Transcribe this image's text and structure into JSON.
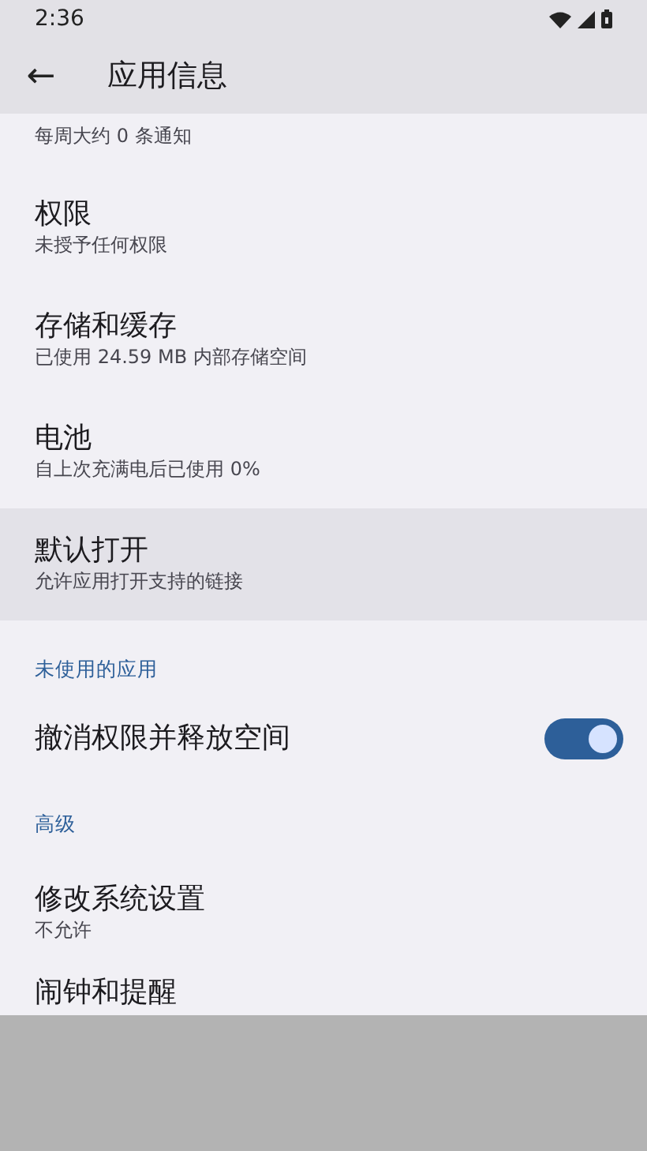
{
  "status_bar": {
    "time": "2:36"
  },
  "app_bar": {
    "back": "←",
    "title": "应用信息"
  },
  "rows": [
    {
      "kind": "cut",
      "subtitle": "每周大约 0 条通知"
    },
    {
      "kind": "item",
      "title": "权限",
      "subtitle": "未授予任何权限",
      "selected": false
    },
    {
      "kind": "item",
      "title": "存储和缓存",
      "subtitle": "已使用 24.59 MB 内部存储空间",
      "selected": false
    },
    {
      "kind": "item",
      "title": "电池",
      "subtitle": "自上次充满电后已使用 0%",
      "selected": false
    },
    {
      "kind": "item",
      "title": "默认打开",
      "subtitle": "允许应用打开支持的链接",
      "selected": true
    },
    {
      "kind": "header",
      "title": "未使用的应用"
    },
    {
      "kind": "switch",
      "title": "撤消权限并释放空间",
      "on": true
    },
    {
      "kind": "header",
      "title": "高级"
    },
    {
      "kind": "item",
      "title": "修改系统设置",
      "subtitle": "不允许",
      "selected": false
    },
    {
      "kind": "item",
      "title": "闹钟和提醒",
      "selected": false
    }
  ]
}
